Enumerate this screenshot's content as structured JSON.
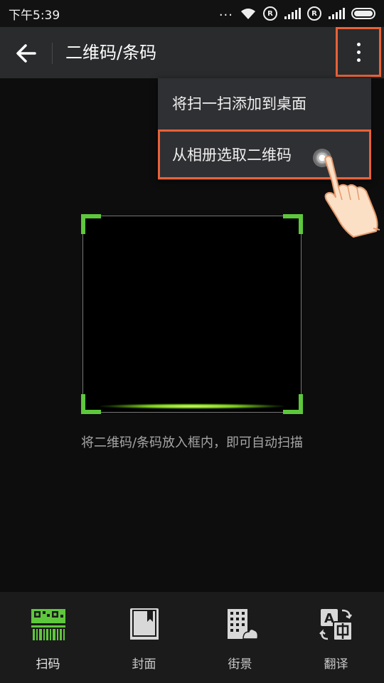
{
  "status_bar": {
    "time": "下午5:39",
    "dots": "...",
    "reg_mark_1": "R",
    "reg_mark_2": "R"
  },
  "app_bar": {
    "title": "二维码/条码",
    "back_icon": "arrow-left-icon",
    "more_icon": "more-vertical-icon"
  },
  "menu": {
    "items": [
      {
        "label": "将扫一扫添加到桌面"
      },
      {
        "label": "从相册选取二维码"
      }
    ]
  },
  "scanner": {
    "hint": "将二维码/条码放入框内，即可自动扫描",
    "corner_color": "#5ec83c"
  },
  "highlight_color": "#e8623a",
  "bottom_nav": {
    "active_color": "#5ec83c",
    "items": [
      {
        "label": "扫码",
        "icon": "barcode-scan-icon"
      },
      {
        "label": "封面",
        "icon": "book-cover-icon"
      },
      {
        "label": "街景",
        "icon": "street-view-icon"
      },
      {
        "label": "翻译",
        "icon": "translate-icon"
      }
    ]
  }
}
